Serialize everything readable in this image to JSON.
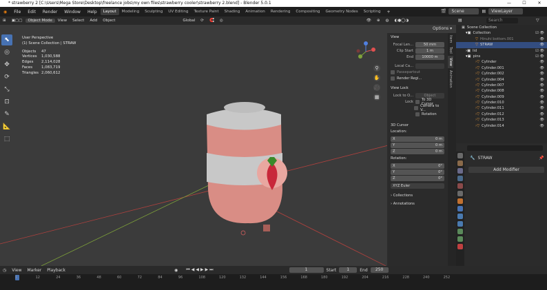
{
  "titlebar": {
    "title": "* strawberry 2 [C:\\Users\\Mega Store\\Desktop\\freelance jobs\\my own files\\strawberry cooler\\strawberry 2.blend] - Blender 5.0.1"
  },
  "menu": {
    "items": [
      "File",
      "Edit",
      "Render",
      "Window",
      "Help"
    ],
    "workspaces": [
      "Layout",
      "Modeling",
      "Sculpting",
      "UV Editing",
      "Texture Paint",
      "Shading",
      "Animation",
      "Rendering",
      "Compositing",
      "Geometry Nodes",
      "Scripting"
    ],
    "scene": "Scene",
    "view_layer": "ViewLayer"
  },
  "header": {
    "mode": "Object Mode",
    "view": "View",
    "select": "Select",
    "add": "Add",
    "object": "Object",
    "orientation": "Global",
    "options": "Options"
  },
  "overlay": {
    "view_name": "User Perspective",
    "collection": "(1) Scene Collection | STRAW",
    "stats": [
      {
        "k": "Objects",
        "v": "47"
      },
      {
        "k": "Vertices",
        "v": "1,030,588"
      },
      {
        "k": "Edges",
        "v": "2,114,028"
      },
      {
        "k": "Faces",
        "v": "1,083,719"
      },
      {
        "k": "Triangles",
        "v": "2,060,612"
      }
    ]
  },
  "npanel": {
    "view_title": "View",
    "focal_label": "Focal Len...",
    "focal": "50 mm",
    "clip_start_label": "Clip Start",
    "clip_start": "1 m",
    "end_label": "End",
    "end": "10000 m",
    "local_cam": "Local Ca...",
    "passepartout": "Passepartout",
    "render_region": "Render Regi...",
    "view_lock": "View Lock",
    "lock_to": "Lock to O...",
    "object_ph": "Object",
    "lock": "Lock",
    "to_3d_cursor": "To 3D Cursor",
    "camera_to_view": "Camera to V...",
    "rotation": "Rotation",
    "cursor_title": "3D Cursor",
    "location": "Location:",
    "x": "X",
    "y": "Y",
    "z": "Z",
    "x_val": "0 m",
    "y_val": "0 m",
    "z_val": "0 m",
    "rotation_label": "Rotation:",
    "rx": "0°",
    "ry": "0°",
    "rz": "0°",
    "euler": "XYZ Euler",
    "collections": "Collections",
    "annotations": "Annotations",
    "tabs": [
      "Item",
      "Tool",
      "View",
      "Animation"
    ]
  },
  "outliner": {
    "search_ph": "Search",
    "rows": [
      {
        "name": "Scene Collection",
        "indent": 0
      },
      {
        "name": "Collection",
        "indent": 1
      },
      {
        "name": "Hinuhi bottom.001",
        "indent": 2
      },
      {
        "name": "STRAW",
        "indent": 2,
        "selected": true
      },
      {
        "name": "lid",
        "indent": 1
      },
      {
        "name": "pins",
        "indent": 1
      },
      {
        "name": "Cylinder",
        "indent": 2
      },
      {
        "name": "Cylinder.001",
        "indent": 2
      },
      {
        "name": "Cylinder.002",
        "indent": 2
      },
      {
        "name": "Cylinder.004",
        "indent": 2
      },
      {
        "name": "Cylinder.007",
        "indent": 2
      },
      {
        "name": "Cylinder.008",
        "indent": 2
      },
      {
        "name": "Cylinder.009",
        "indent": 2
      },
      {
        "name": "Cylinder.010",
        "indent": 2
      },
      {
        "name": "Cylinder.011",
        "indent": 2
      },
      {
        "name": "Cylinder.012",
        "indent": 2
      },
      {
        "name": "Cylinder.013",
        "indent": 2
      },
      {
        "name": "Cylinder.014",
        "indent": 2
      }
    ]
  },
  "properties": {
    "object_name": "STRAW",
    "add_modifier": "Add Modifier"
  },
  "timeline": {
    "view": "View",
    "marker": "Marker",
    "playback": "Playback",
    "current": "1",
    "start_label": "Start",
    "start": "1",
    "end_label": "End",
    "end": "250",
    "ticks": [
      "1",
      "12",
      "24",
      "36",
      "48",
      "60",
      "72",
      "84",
      "96",
      "108",
      "120",
      "132",
      "144",
      "156",
      "168",
      "180",
      "192",
      "204",
      "216",
      "228",
      "240",
      "252"
    ]
  },
  "colors": {
    "accent": "#4772b3",
    "cooler_pink": "#d98d85",
    "cooler_grey": "#c8c8c8",
    "strawberry": "#c8283a",
    "x_axis": "#b0413e",
    "y_axis": "#7fa33a"
  }
}
